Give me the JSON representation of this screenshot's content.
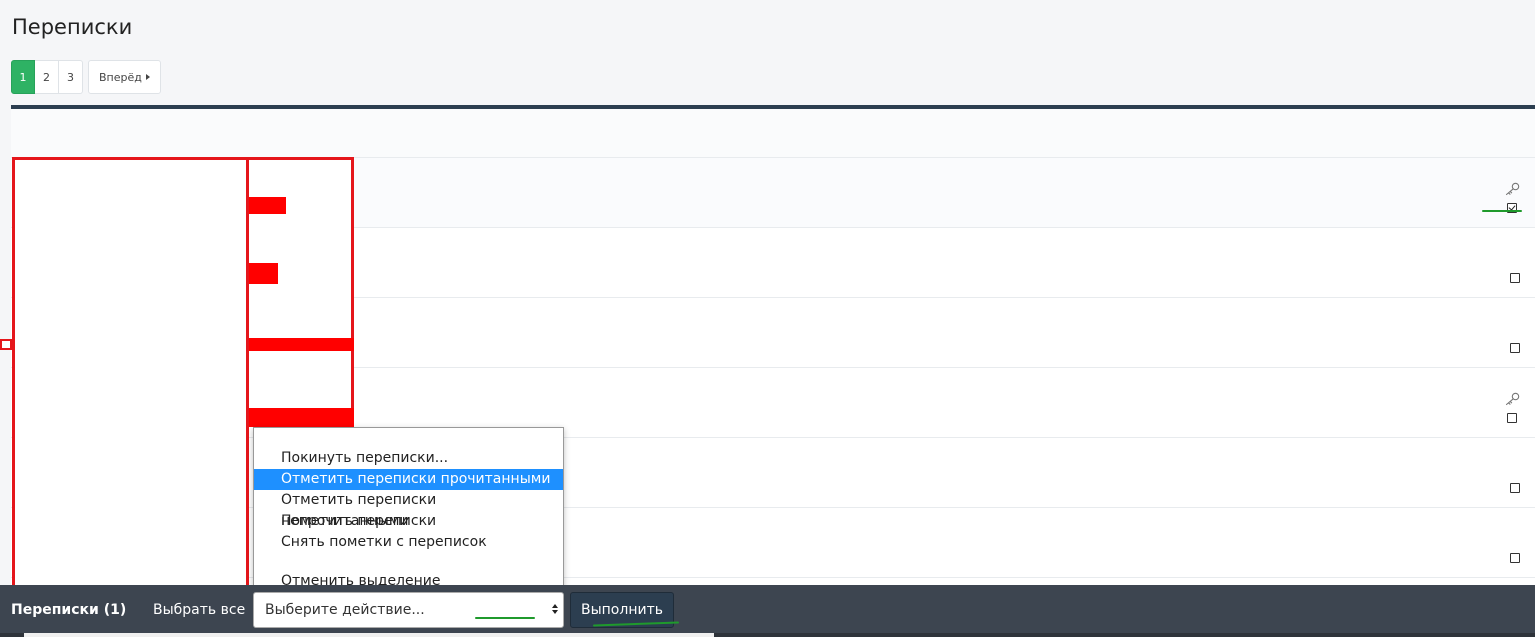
{
  "page": {
    "title": "Переписки"
  },
  "pagination": {
    "pages": [
      "1",
      "2",
      "3"
    ],
    "active_page": "1",
    "next_label": "Вперёд"
  },
  "rows": [
    {
      "checked": true,
      "has_key_icon": true
    },
    {
      "checked": false,
      "has_key_icon": false
    },
    {
      "checked": false,
      "has_key_icon": false
    },
    {
      "checked": false,
      "has_key_icon": true
    },
    {
      "checked": false,
      "has_key_icon": false
    },
    {
      "checked": false,
      "has_key_icon": false
    }
  ],
  "dropdown": {
    "options": [
      "Покинуть переписки...",
      "Отметить переписки прочитанными",
      "Отметить переписки непрочитанными",
      "Пометить переписки",
      "Снять пометки с переписок",
      "Отменить выделение"
    ],
    "highlighted_index": 1
  },
  "bottom_bar": {
    "title": "Переписки (1)",
    "select_all": "Выбрать все",
    "action_placeholder": "Выберите действие...",
    "run_label": "Выполнить"
  },
  "colors": {
    "active_page": "#2eb264",
    "list_top_border": "#2c3e50",
    "bottom_bar": "#3d4550",
    "highlight": "#1e90ff",
    "redaction": "#ff0000",
    "marker": "#1f9a2c"
  }
}
